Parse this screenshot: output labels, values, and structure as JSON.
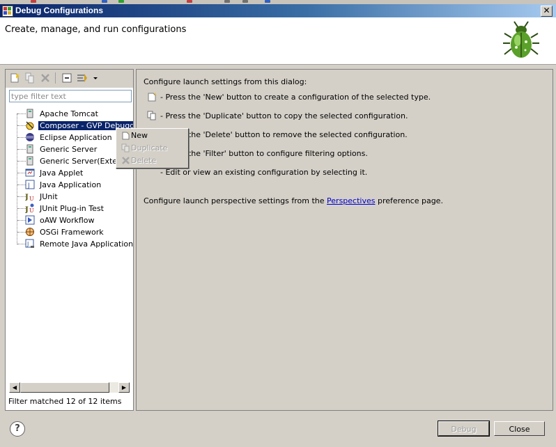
{
  "window": {
    "title": "Debug Configurations",
    "close_glyph": "✕"
  },
  "header": {
    "title": "Create, manage, and run configurations",
    "icon": "bug-icon"
  },
  "left_panel": {
    "toolbar_icons": [
      "new-config-icon",
      "duplicate-icon",
      "delete-icon",
      "collapse-all-icon",
      "filter-icon",
      "dropdown-icon"
    ],
    "filter_placeholder": "type filter text",
    "tree_items": [
      {
        "label": "Apache Tomcat",
        "icon": "tomcat-icon"
      },
      {
        "label": "Composer - GVP Debugger",
        "icon": "composer-icon",
        "selected": true
      },
      {
        "label": "Eclipse Application",
        "icon": "eclipse-icon"
      },
      {
        "label": "Generic Server",
        "icon": "server-icon"
      },
      {
        "label": "Generic Server(External Launch)",
        "icon": "server-external-icon"
      },
      {
        "label": "Java Applet",
        "icon": "applet-icon"
      },
      {
        "label": "Java Application",
        "icon": "java-app-icon"
      },
      {
        "label": "JUnit",
        "icon": "junit-icon"
      },
      {
        "label": "JUnit Plug-in Test",
        "icon": "junit-plugin-icon"
      },
      {
        "label": "oAW Workflow",
        "icon": "workflow-icon"
      },
      {
        "label": "OSGi Framework",
        "icon": "osgi-icon"
      },
      {
        "label": "Remote Java Application",
        "icon": "remote-java-icon"
      }
    ],
    "status": "Filter matched 12 of 12 items"
  },
  "context_menu": {
    "items": [
      {
        "label": "New",
        "enabled": true
      },
      {
        "label": "Duplicate",
        "enabled": false
      },
      {
        "label": "Delete",
        "enabled": false
      }
    ]
  },
  "right_panel": {
    "intro": "Configure launch settings from this dialog:",
    "lines": [
      "- Press the 'New' button to create a configuration of the selected type.",
      "- Press the 'Duplicate' button to copy the selected configuration.",
      "- Press the 'Delete' button to remove the selected configuration.",
      "- Press the 'Filter' button to configure filtering options.",
      "- Edit or view an existing configuration by selecting it."
    ],
    "perspective_prefix": "Configure launch perspective settings from the",
    "perspective_link": "Perspectives",
    "perspective_suffix": "preference page."
  },
  "footer": {
    "help": "?",
    "debug_label": "Debug",
    "close_label": "Close"
  },
  "colors": {
    "selection": "#0a246a",
    "title_start": "#0a246a",
    "title_end": "#a6caf0",
    "link": "#0000cc"
  }
}
